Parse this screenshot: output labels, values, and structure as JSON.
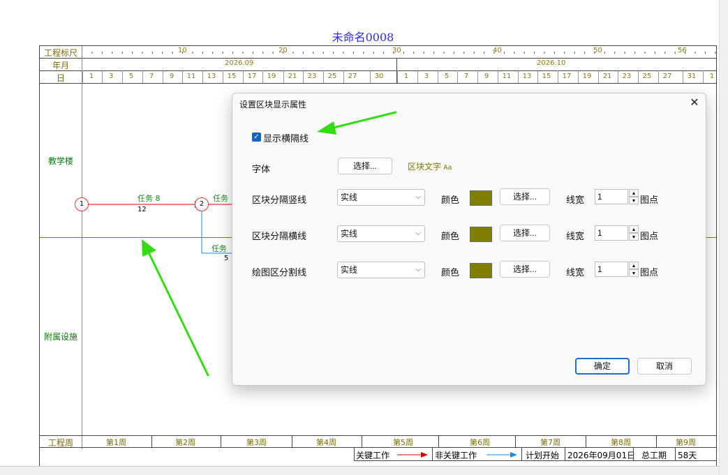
{
  "chart": {
    "title": "未命名0008",
    "ruler_label": "工程标尺",
    "month_label": "年月",
    "day_label": "日",
    "ruler_ticks": [
      "10",
      "20",
      "30",
      "40",
      "50",
      "56"
    ],
    "months": [
      "2026.09",
      "2026.10"
    ],
    "days": [
      "1",
      "3",
      "5",
      "7",
      "9",
      "11",
      "13",
      "15",
      "17",
      "19",
      "21",
      "23",
      "25",
      "27",
      "30",
      "1",
      "3",
      "5",
      "7",
      "9",
      "11",
      "13",
      "15",
      "17",
      "19",
      "21",
      "23",
      "25",
      "27",
      "31",
      "1"
    ],
    "groups": [
      "教学楼",
      "附属设施"
    ],
    "week_label": "工程周",
    "weeks": [
      "第1周",
      "第2周",
      "第3周",
      "第4周",
      "第5周",
      "第6周",
      "第7周",
      "第8周",
      "第9周"
    ],
    "nodes": [
      "1",
      "2"
    ],
    "tasks": [
      {
        "label": "任务 8",
        "duration": "12"
      },
      {
        "label": "任务",
        "duration": ""
      },
      {
        "label": "任务",
        "duration": "5"
      }
    ],
    "legend": {
      "critical": "关键工作",
      "noncritical": "非关键工作",
      "plan_start_label": "计划开始",
      "plan_start_value": "2026年09月01日",
      "total_label": "总工期",
      "total_value": "58天"
    },
    "colors": {
      "critical": "#e00000",
      "noncritical": "#1e88e5",
      "division": "#808000"
    }
  },
  "dialog": {
    "title": "设置区块显示属性",
    "close_icon": "close-icon",
    "show_hline_label": "显示横隔线",
    "show_hline_checked": true,
    "font_label": "字体",
    "font_button": "选择...",
    "font_sample": "区块文字",
    "font_sample_aa": "Aa",
    "rows": [
      {
        "label": "区块分隔竖线",
        "style": "实线",
        "color_label": "颜色",
        "color": "#808000",
        "button": "选择...",
        "width_label": "线宽",
        "width": "1",
        "unit": "图点"
      },
      {
        "label": "区块分隔横线",
        "style": "实线",
        "color_label": "颜色",
        "color": "#808000",
        "button": "选择...",
        "width_label": "线宽",
        "width": "1",
        "unit": "图点"
      },
      {
        "label": "绘图区分割线",
        "style": "实线",
        "color_label": "颜色",
        "color": "#808000",
        "button": "选择...",
        "width_label": "线宽",
        "width": "1",
        "unit": "图点"
      }
    ],
    "ok": "确定",
    "cancel": "取消"
  },
  "annotation_color": "#33dd11"
}
